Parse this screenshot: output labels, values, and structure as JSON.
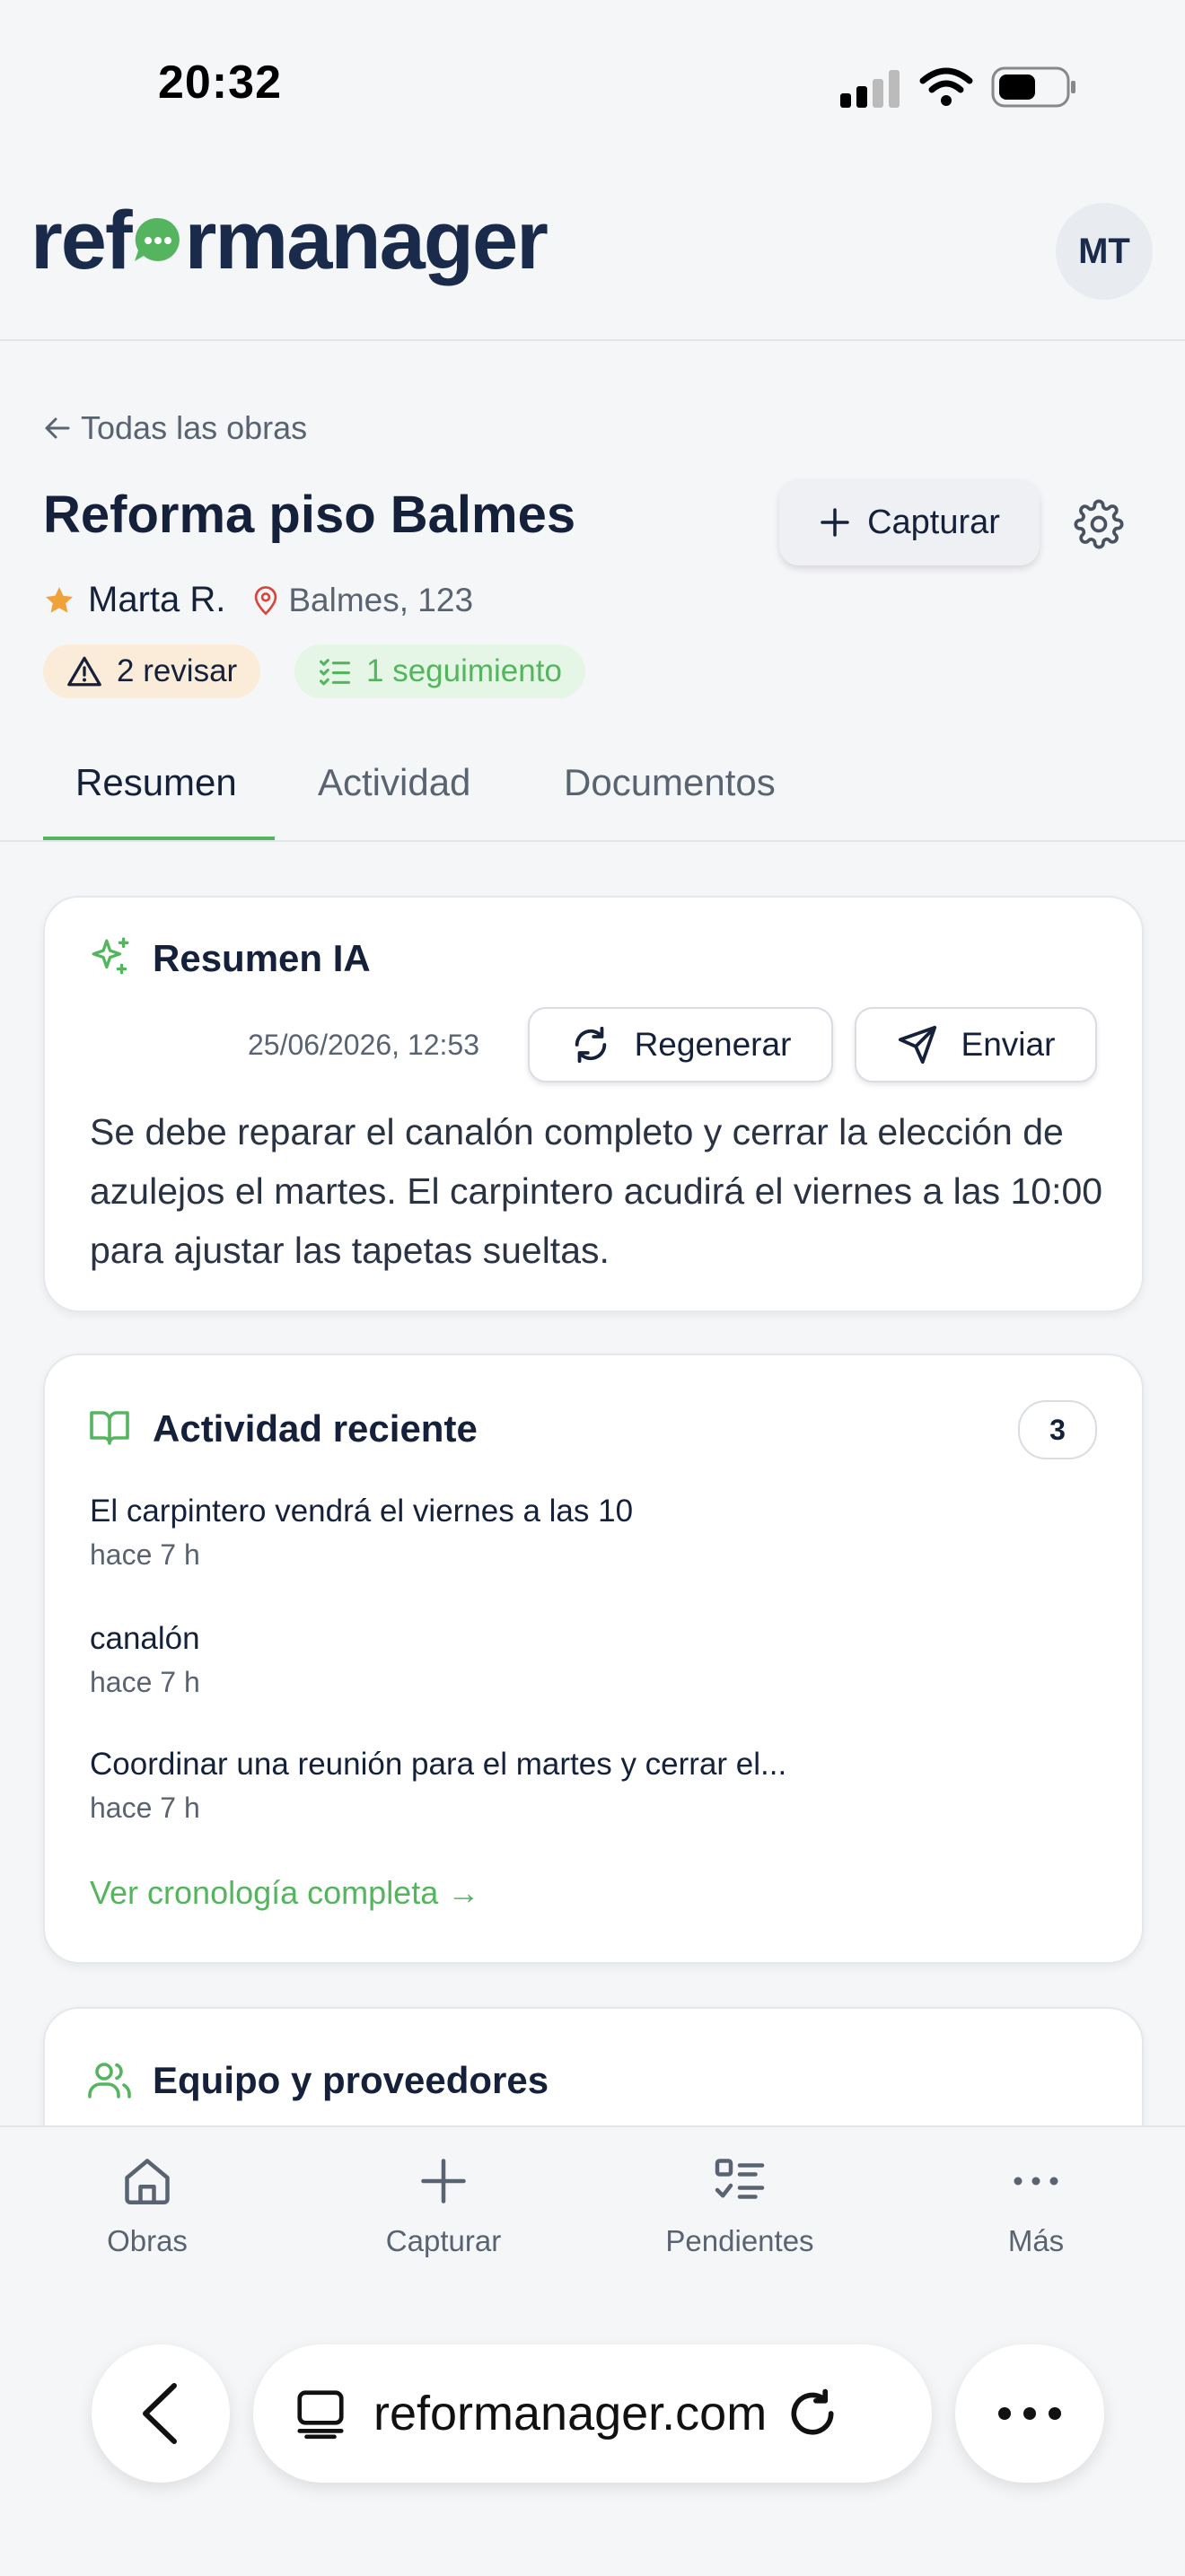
{
  "status_bar": {
    "time": "20:32"
  },
  "header": {
    "logo_prefix": "ref",
    "logo_suffix": "rmanager",
    "avatar_initials": "MT"
  },
  "project": {
    "back_label": "Todas las obras",
    "title": "Reforma piso Balmes",
    "capture_label": "Capturar",
    "owner": "Marta R.",
    "location": "Balmes, 123",
    "badges": {
      "review": "2 revisar",
      "followup": "1 seguimiento"
    }
  },
  "tabs": [
    {
      "label": "Resumen",
      "active": true
    },
    {
      "label": "Actividad",
      "active": false
    },
    {
      "label": "Documentos",
      "active": false
    }
  ],
  "ai_summary": {
    "title": "Resumen IA",
    "timestamp": "25/06/2026, 12:53",
    "regenerate_label": "Regenerar",
    "send_label": "Enviar",
    "text": "Se debe reparar el canalón completo y cerrar la elección de azulejos el martes. El carpintero acudirá el viernes a las 10:00 para ajustar las tapetas sueltas."
  },
  "recent_activity": {
    "title": "Actividad reciente",
    "count": "3",
    "items": [
      {
        "title": "El carpintero vendrá el viernes a las 10",
        "time": "hace 7 h"
      },
      {
        "title": "canalón",
        "time": "hace 7 h"
      },
      {
        "title": "Coordinar una reunión para el martes y cerrar el...",
        "time": "hace 7 h"
      }
    ],
    "timeline_link": "Ver cronología completa →"
  },
  "team": {
    "title": "Equipo y proveedores"
  },
  "bottom_nav": [
    {
      "label": "Obras",
      "icon": "home-icon"
    },
    {
      "label": "Capturar",
      "icon": "plus-icon"
    },
    {
      "label": "Pendientes",
      "icon": "checklist-icon"
    },
    {
      "label": "Más",
      "icon": "more-icon"
    }
  ],
  "browser": {
    "url": "reformanager.com"
  },
  "colors": {
    "accent_green": "#55b55e",
    "brand_navy": "#1a2a4a",
    "star": "#f0a23a",
    "location_pin": "#d9453d",
    "review_badge_bg": "#fbecd9",
    "followup_badge_bg": "#e5f5e6"
  }
}
